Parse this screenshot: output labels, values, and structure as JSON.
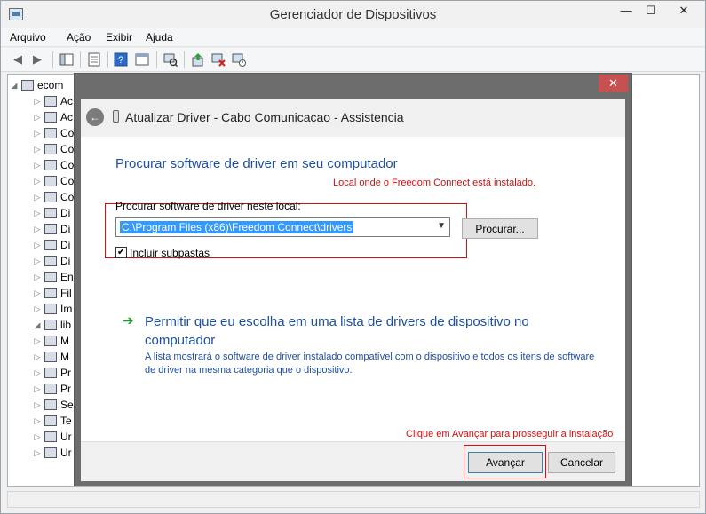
{
  "window": {
    "title": "Gerenciador de Dispositivos",
    "minimize": "—",
    "maximize": "☐",
    "close": "✕"
  },
  "menu": [
    "Arquivo",
    "Ação",
    "Exibir",
    "Ajuda"
  ],
  "tree": {
    "root": "ecom",
    "items": [
      "Ac",
      "Ac",
      "Co",
      "Co",
      "Co",
      "Co",
      "Co",
      "Di",
      "Di",
      "Di",
      "Di",
      "En",
      "Fil",
      "Im",
      "lib",
      "M",
      "M",
      "Pr",
      "Pr",
      "Se",
      "Te",
      "Ur",
      "Ur"
    ]
  },
  "dialog": {
    "close": "✕",
    "back": "←",
    "title": "Atualizar Driver -  Cabo Comunicacao - Assistencia",
    "heading": "Procurar software de driver em seu computador",
    "annotation_top": "Local onde o Freedom Connect está instalado.",
    "field_label": "Procurar software de driver neste local:",
    "path_value": "C:\\Program Files (x86)\\Freedom Connect\\drivers",
    "browse_label": "Procurar...",
    "include_subfolders_label": "Incluir subpastas",
    "include_subfolders_checked": "✔",
    "option_arrow": "➔",
    "option_title": "Permitir que eu escolha em uma lista de drivers de dispositivo no computador",
    "option_desc": "A lista mostrará o software de driver instalado compatível com o dispositivo e todos os itens de software de driver na mesma categoria que o dispositivo.",
    "annotation_bottom": "Clique em Avançar para prosseguir a instalação",
    "next_label": "Avançar",
    "cancel_label": "Cancelar"
  },
  "colors": {
    "link_blue": "#1e4fa0",
    "annotation_red": "#cc1111",
    "close_red": "#c75050",
    "selection_blue": "#3399ff"
  }
}
